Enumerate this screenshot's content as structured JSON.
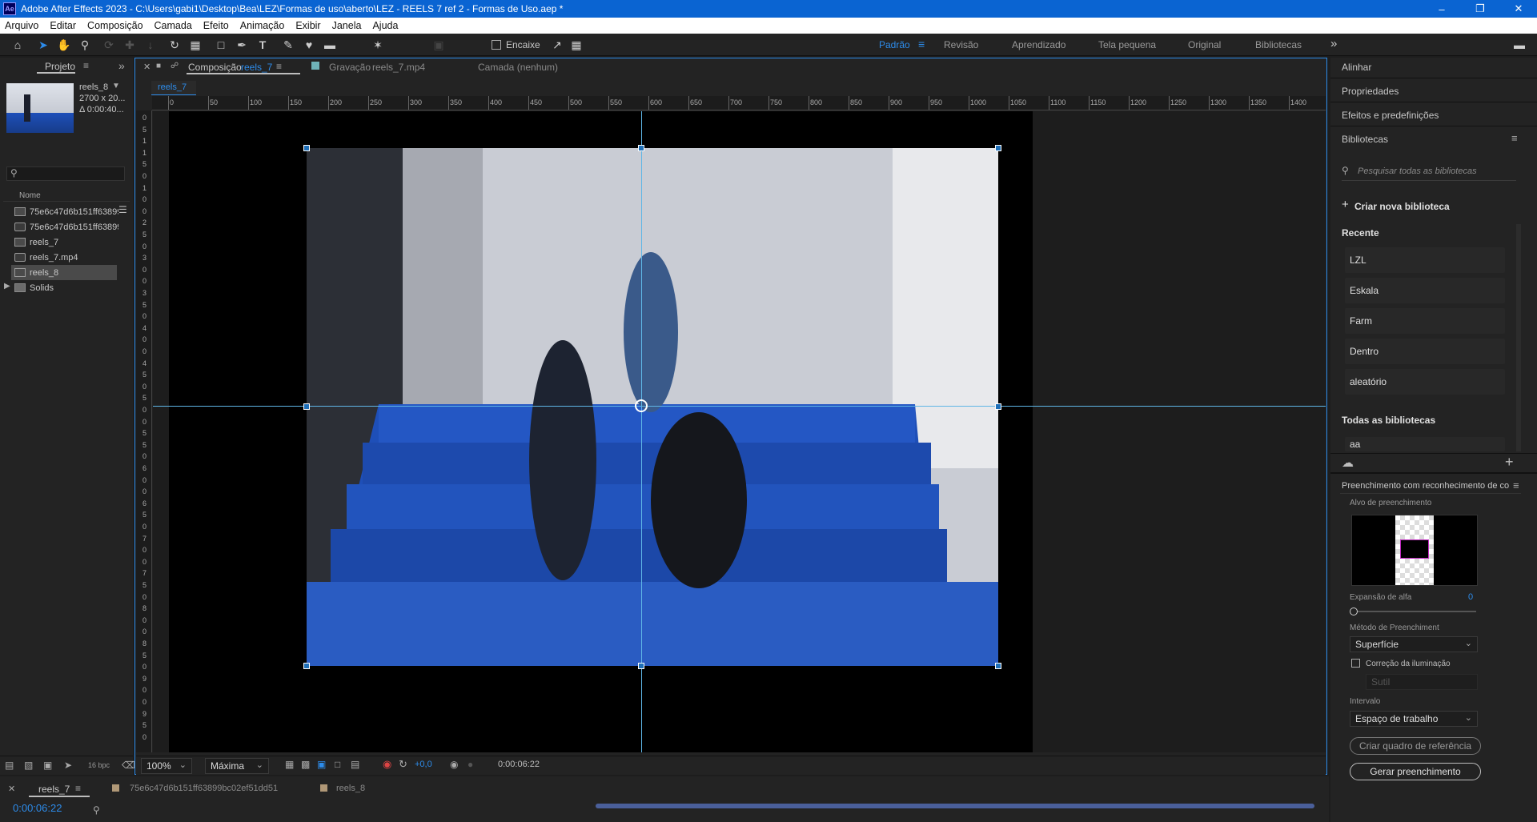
{
  "window": {
    "title": "Adobe After Effects 2023 - C:\\Users\\gabi1\\Desktop\\Bea\\LEZ\\Formas de uso\\aberto\\LEZ - REELS 7 ref 2 - Formas de Uso.aep *",
    "logo": "Ae"
  },
  "menu": [
    "Arquivo",
    "Editar",
    "Composição",
    "Camada",
    "Efeito",
    "Animação",
    "Exibir",
    "Janela",
    "Ajuda"
  ],
  "toolbar": {
    "snap_label": "Encaixe",
    "workspaces": [
      "Padrão",
      "Revisão",
      "Aprendizado",
      "Tela pequena",
      "Original",
      "Bibliotecas"
    ],
    "active_workspace": "Padrão"
  },
  "project": {
    "tab": "Projeto",
    "thumb_name": "reels_8",
    "thumb_dims": "2700 x 20...",
    "thumb_dur": "Δ 0:00:40...",
    "search_placeholder": "",
    "column_name": "Nome",
    "items": [
      {
        "name": "75e6c47d6b151ff63899",
        "type": "comp"
      },
      {
        "name": "75e6c47d6b151ff63899",
        "type": "footage"
      },
      {
        "name": "reels_7",
        "type": "comp"
      },
      {
        "name": "reels_7.mp4",
        "type": "footage"
      },
      {
        "name": "reels_8",
        "type": "comp",
        "selected": true
      },
      {
        "name": "Solids",
        "type": "folder"
      }
    ],
    "bpc": "16 bpc"
  },
  "viewer": {
    "tab_comp_prefix": "Composição",
    "tab_comp_name": "reels_7",
    "tab_footage_prefix": "Gravação",
    "tab_footage_name": "reels_7.mp4",
    "tab_layer": "Camada (nenhum)",
    "breadcrumb": "reels_7",
    "ruler_top": [
      "0",
      "50",
      "100",
      "150",
      "200",
      "250",
      "300",
      "350",
      "400",
      "450",
      "500",
      "550",
      "600",
      "650",
      "700",
      "750",
      "800",
      "850",
      "900",
      "950",
      "1000",
      "1050",
      "1100",
      "1150",
      "1200",
      "1250",
      "1300",
      "1350",
      "1400"
    ],
    "ruler_left": [
      "0",
      "5",
      "1",
      "1",
      "5",
      "0",
      "1",
      "0",
      "0",
      "2",
      "5",
      "0",
      "3",
      "0",
      "0",
      "3",
      "5",
      "0",
      "4",
      "0",
      "0",
      "4",
      "5",
      "0",
      "5",
      "0",
      "0",
      "5",
      "5",
      "0",
      "6",
      "0",
      "0",
      "6",
      "5",
      "0",
      "7",
      "0",
      "0",
      "7",
      "5",
      "0",
      "8",
      "0",
      "0",
      "8",
      "5",
      "0",
      "9",
      "0",
      "0",
      "9",
      "5",
      "0"
    ],
    "zoom": "100%",
    "resolution": "Máxima",
    "exposure": "+0,0",
    "timecode": "0:00:06:22"
  },
  "timeline": {
    "tabs": [
      "reels_7",
      "75e6c47d6b151ff63899bc02ef51dd51",
      "reels_8"
    ],
    "timecode": "0:00:06:22",
    "colors": {
      "reels_7": "#b09877",
      "comp_b": "#b09877",
      "reels_8": "#b09877"
    }
  },
  "right": {
    "panels": [
      "Alinhar",
      "Propriedades",
      "Efeitos e predefinições",
      "Bibliotecas"
    ],
    "search_placeholder": "Pesquisar todas as bibliotecas",
    "create_library": "Criar nova biblioteca",
    "recent_title": "Recente",
    "recent": [
      "LZL",
      "Eskala",
      "Farm",
      "Dentro",
      "aleatório"
    ],
    "all_title": "Todas as bibliotecas",
    "all_first": "aa",
    "fill_panel_title": "Preenchimento com reconhecimento de co",
    "fill_target": "Alvo de preenchimento",
    "alpha_label": "Expansão de alfa",
    "alpha_value": "0",
    "alpha_level": 0,
    "method_label": "Método de Preenchiment",
    "method_value": "Superfície",
    "lighting_label": "Correção da iluminação",
    "lighting_value": "Sutil",
    "interval_label": "Intervalo",
    "interval_value": "Espaço de trabalho",
    "btn_reference": "Criar quadro de referência",
    "btn_generate": "Gerar preenchimento"
  },
  "colors": {
    "accent": "#2d8ceb",
    "title_bar": "#0a64d2",
    "stairs_blue": "#1e4fb8"
  }
}
